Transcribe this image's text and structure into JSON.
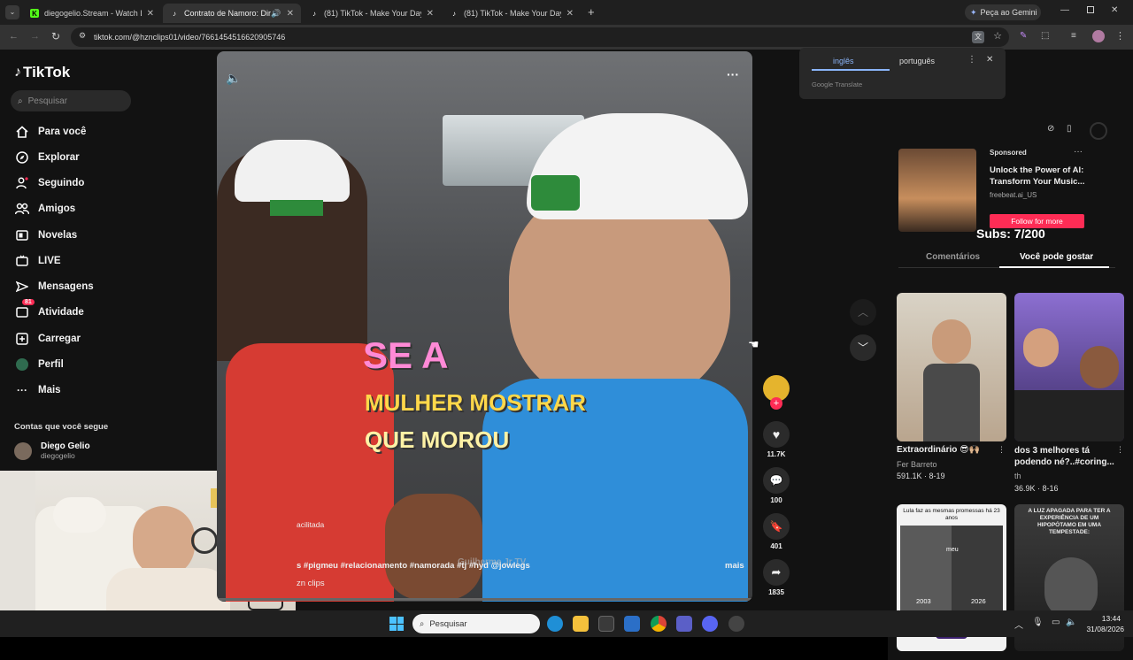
{
  "browser": {
    "tabs": [
      {
        "title": "diegogelio.Stream - Watch Live",
        "icon": "kick-icon"
      },
      {
        "title": "Contrato de Namoro: Direi",
        "icon": "tiktok-icon"
      },
      {
        "title": "(81) TikTok - Make Your Day",
        "icon": "tiktok-icon"
      },
      {
        "title": "(81) TikTok - Make Your Day",
        "icon": "tiktok-icon"
      }
    ],
    "gemini_label": "Peça ao Gemini",
    "url": "tiktok.com/@hznclips01/video/7661454516620905746"
  },
  "translate": {
    "lang_from": "inglês",
    "lang_to": "português",
    "footer": "Google Translate"
  },
  "sidebar": {
    "logo": "TikTok",
    "search_placeholder": "Pesquisar",
    "items": [
      {
        "label": "Para você",
        "icon": "home-icon"
      },
      {
        "label": "Explorar",
        "icon": "compass-icon"
      },
      {
        "label": "Seguindo",
        "icon": "following-icon"
      },
      {
        "label": "Amigos",
        "icon": "friends-icon"
      },
      {
        "label": "Novelas",
        "icon": "novelas-icon"
      },
      {
        "label": "LIVE",
        "icon": "live-icon"
      },
      {
        "label": "Mensagens",
        "icon": "messages-icon"
      },
      {
        "label": "Atividade",
        "icon": "activity-icon",
        "badge": "81"
      },
      {
        "label": "Carregar",
        "icon": "upload-icon"
      },
      {
        "label": "Perfil",
        "icon": "profile-icon"
      },
      {
        "label": "Mais",
        "icon": "more-icon"
      }
    ],
    "following_title": "Contas que você segue",
    "account": {
      "name": "Diego Gelio",
      "handle": "diegogelio"
    }
  },
  "video": {
    "caption_lines": [
      "SE A",
      "MULHER MOSTRAR",
      "QUE MOROU"
    ],
    "description": "s #pigmeu #relacionamento #namorada #tj #hyd @jowlegs",
    "more_label": "mais",
    "author_partial": "zn clips",
    "music_partial": "acilitada",
    "watermark": "Guilherme Jr TV"
  },
  "actions": {
    "likes": "11.7K",
    "comments": "100",
    "saves": "401",
    "shares": "1835"
  },
  "overlay": {
    "subs": "Subs: 7/200"
  },
  "ad": {
    "sponsored": "Sponsored",
    "title": "Unlock the Power of AI: Transform Your Music...",
    "source": "freebeat.ai_US",
    "cta": "Follow for more"
  },
  "right_tabs": {
    "comments": "Comentários",
    "suggest": "Você pode gostar"
  },
  "cards": [
    {
      "title": "Extraordinário 😎🙌🏼",
      "user": "Fer Barreto",
      "meta": "591.1K · 8-19"
    },
    {
      "title": "dos 3 melhores tá podendo né?..#coring...",
      "user": "th",
      "meta": "36.9K · 8-16"
    },
    {
      "title": "",
      "user": "",
      "meta": "",
      "overlay_text": "Lula faz as mesmas promessas há 23 anos",
      "y1": "2003",
      "y2": "2026",
      "mid": "meu"
    },
    {
      "title": "",
      "user": "",
      "meta": "",
      "overlay_text": "A LUZ APAGADA PARA TER A EXPERIÊNCIA DE UM HIPOPÓTAMO EM UMA TEMPESTADE:"
    }
  ],
  "taskbar": {
    "search_placeholder": "Pesquisar",
    "time": "13:44",
    "date": "31/08/2026"
  }
}
